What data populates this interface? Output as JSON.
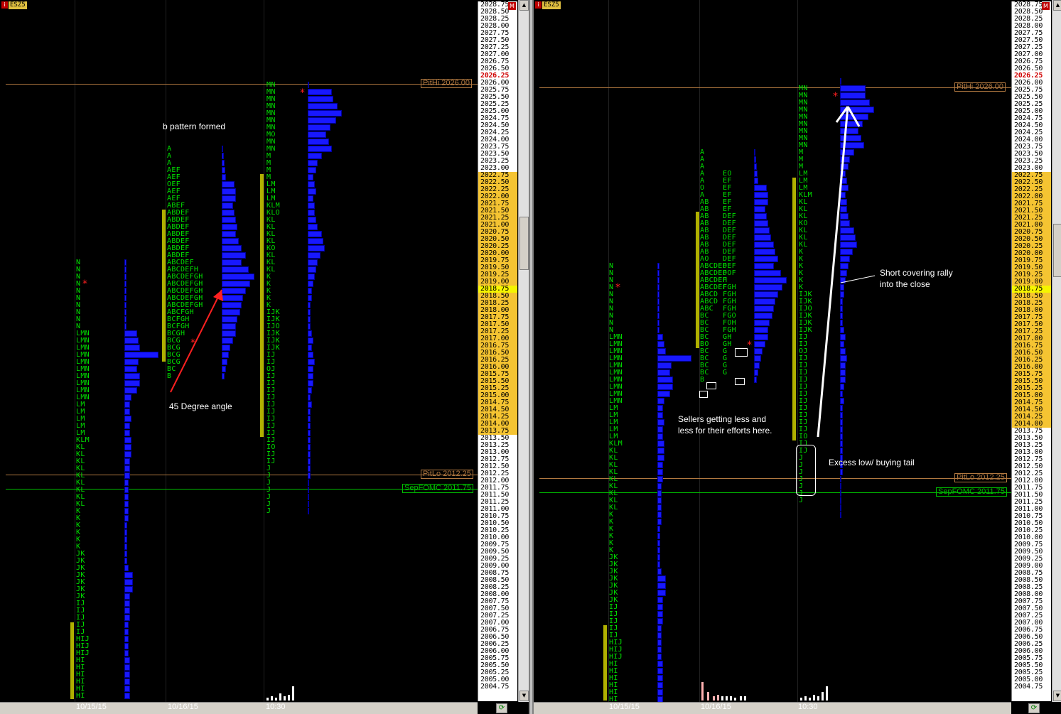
{
  "symbol": "ESZ5",
  "symbol_icon": "i",
  "axis_m_icon": "M",
  "prices_left": [
    "2028.75",
    "2028.50",
    "2028.25",
    "2028.00",
    "2027.75",
    "2027.50",
    "2027.25",
    "2027.00",
    "2026.75",
    "2026.50",
    "2026.25",
    "2026.00",
    "2025.75",
    "2025.50",
    "2025.25",
    "2025.00",
    "2024.75",
    "2024.50",
    "2024.25",
    "2024.00",
    "2023.75",
    "2023.50",
    "2023.25",
    "2023.00",
    "2022.75",
    "2022.50",
    "2022.25",
    "2022.00",
    "2021.75",
    "2021.50",
    "2021.25",
    "2021.00",
    "2020.75",
    "2020.50",
    "2020.25",
    "2020.00",
    "2019.75",
    "2019.50",
    "2019.25",
    "2019.00",
    "2018.75",
    "2018.50",
    "2018.25",
    "2018.00",
    "2017.75",
    "2017.50",
    "2017.25",
    "2017.00",
    "2016.75",
    "2016.50",
    "2016.25",
    "2016.00",
    "2015.75",
    "2015.50",
    "2015.25",
    "2015.00",
    "2014.75",
    "2014.50",
    "2014.25",
    "2014.00",
    "2013.75",
    "2013.50",
    "2013.25",
    "2013.00",
    "2012.75",
    "2012.50",
    "2012.25",
    "2012.00",
    "2011.75",
    "2011.50",
    "2011.25",
    "2011.00",
    "2010.75",
    "2010.50",
    "2010.25",
    "2010.00",
    "2009.75",
    "2009.50",
    "2009.25",
    "2009.00",
    "2008.75",
    "2008.50",
    "2008.25",
    "2008.00",
    "2007.75",
    "2007.50",
    "2007.25",
    "2007.00",
    "2006.75",
    "2006.50",
    "2006.25",
    "2006.00",
    "2005.75",
    "2005.50",
    "2005.25",
    "2005.00",
    "2004.75"
  ],
  "prices_right": [
    "2028.75",
    "2028.50",
    "2028.25",
    "2028.00",
    "2027.75",
    "2027.50",
    "2027.25",
    "2027.00",
    "2026.75",
    "2026.50",
    "2026.25",
    "2026.00",
    "2025.75",
    "2025.50",
    "2025.25",
    "2025.00",
    "2024.75",
    "2024.50",
    "2024.25",
    "2024.00",
    "2023.75",
    "2023.50",
    "2023.25",
    "2023.00",
    "2022.75",
    "2022.50",
    "2022.25",
    "2022.00",
    "2021.75",
    "2021.50",
    "2021.25",
    "2021.00",
    "2020.75",
    "2020.50",
    "2020.25",
    "2020.00",
    "2019.75",
    "2019.50",
    "2019.25",
    "2019.00",
    "2018.75",
    "2018.50",
    "2018.25",
    "2018.00",
    "2017.75",
    "2017.50",
    "2017.25",
    "2017.00",
    "2016.75",
    "2016.50",
    "2016.25",
    "2016.00",
    "2015.75",
    "2015.50",
    "2015.25",
    "2015.00",
    "2014.75",
    "2014.50",
    "2014.25",
    "2014.00",
    "2013.75",
    "2013.50",
    "2013.25",
    "2013.00",
    "2012.75",
    "2012.50",
    "2012.25",
    "2012.00",
    "2011.75",
    "2011.50",
    "2011.25",
    "2011.00",
    "2010.75",
    "2010.50",
    "2010.25",
    "2010.00",
    "2009.75",
    "2009.50",
    "2009.25",
    "2009.00",
    "2008.75",
    "2008.50",
    "2008.25",
    "2008.00",
    "2007.75",
    "2007.50",
    "2007.25",
    "2007.00",
    "2006.75",
    "2006.50",
    "2006.25",
    "2006.00",
    "2005.75",
    "2005.50",
    "2005.25",
    "2005.00",
    "2004.75"
  ],
  "ref_lines": {
    "pithi": "PitHi 2026.00",
    "pitlo": "PitLo 2012.25",
    "fomc": "SepFOMC 2011.75"
  },
  "dates": [
    "10/15/15",
    "10/16/15",
    "10:30"
  ],
  "annotations_left": {
    "b_pattern": "b pattern formed",
    "degree": "45 Degree angle"
  },
  "annotations_right": {
    "sellers_line1": "Sellers getting less and",
    "sellers_line2": "less for their efforts here.",
    "short_line1": "Short covering rally",
    "short_line2": "into the close",
    "excess": "Excess low/ buying tail"
  },
  "tpo_left_col1": [
    "N",
    "N",
    "N",
    "N",
    "N",
    "N",
    "N",
    "N",
    "N",
    "N",
    "LMN",
    "LMN",
    "LMN",
    "LMN",
    "LMN",
    "LMN",
    "LMN",
    "LMN",
    "LMN",
    "LMN",
    "LM",
    "LM",
    "LM",
    "LM",
    "LM",
    "KLM",
    "KL",
    "KL",
    "KL",
    "KL",
    "KL",
    "KL",
    "KL",
    "KL",
    "KL",
    "K",
    "K",
    "K",
    "K",
    "K",
    "K",
    "JK",
    "JK",
    "JK",
    "JK",
    "JK",
    "JK",
    "JK",
    "IJ",
    "IJ",
    "IJ",
    "IJ",
    "IJ",
    "HIJ",
    "HIJ",
    "HIJ",
    "HI",
    "HI",
    "HI",
    "HI",
    "HI",
    "HI"
  ],
  "tpo_left_col2": [
    "A",
    "A",
    "A",
    "AEF",
    "AEF",
    "OEF",
    "AEF",
    "AEF",
    "ABEF",
    "ABDEF",
    "ABDEF",
    "ABDEF",
    "ABDEF",
    "ABDEF",
    "ABDEF",
    "ABDEF",
    "ABCDEF",
    "ABCDEFH",
    "ABCDEFGH",
    "ABCDEFGH",
    "ABCDEFGH",
    "ABCDEFGH",
    "ABCDEFGH",
    "ABCFGH",
    "BCFGH",
    "BCFGH",
    "BCGH",
    "BCG",
    "BCG",
    "BCG",
    "BCG",
    "BC",
    "B"
  ],
  "tpo_left_col3": [
    "MN",
    "MN",
    "MN",
    "MN",
    "MN",
    "MN",
    "MN",
    "MO",
    "MN",
    "MN",
    "M",
    "M",
    "M",
    "M",
    "LM",
    "LM",
    "LM",
    "KLM",
    "KLO",
    "KL",
    "KL",
    "KL",
    "KL",
    "KO",
    "KL",
    "KL",
    "KL",
    "K",
    "K",
    "K",
    "K",
    "K",
    "IJK",
    "IJK",
    "IJO",
    "IJK",
    "IJK",
    "IJK",
    "IJ",
    "IJ",
    "OJ",
    "IJ",
    "IJ",
    "IJ",
    "IJ",
    "IJ",
    "IJ",
    "IJ",
    "IJ",
    "IJ",
    "IJ",
    "IO",
    "IJ",
    "IJ",
    "J",
    "J",
    "J",
    "J",
    "J",
    "J",
    "J"
  ],
  "tpo_right_col1": [
    "N",
    "N",
    "N",
    "N",
    "N",
    "N",
    "N",
    "N",
    "N",
    "N",
    "LMN",
    "LMN",
    "LMN",
    "LMN",
    "LMN",
    "LMN",
    "LMN",
    "LMN",
    "LMN",
    "LMN",
    "LM",
    "LM",
    "LM",
    "LM",
    "LM",
    "KLM",
    "KL",
    "KL",
    "KL",
    "KL",
    "KL",
    "KL",
    "KL",
    "KL",
    "KL",
    "K",
    "K",
    "K",
    "K",
    "K",
    "K",
    "JK",
    "JK",
    "JK",
    "JK",
    "JK",
    "JK",
    "JK",
    "IJ",
    "IJ",
    "IJ",
    "IJ",
    "IJ",
    "HIJ",
    "HIJ",
    "HIJ",
    "HI",
    "HI",
    "HI",
    "HI",
    "HI",
    "HI"
  ],
  "tpo_right_col2a": [
    "A",
    "A",
    "A",
    "A",
    "A",
    "O",
    "A",
    "AB",
    "AB",
    "AB",
    "AB",
    "AB",
    "AB",
    "AB",
    "AB",
    "AO",
    "ABCDEF",
    "ABCDEF",
    "ABCDEF",
    "ABCDEF",
    "ABCD",
    "ABCD",
    "ABC",
    "BC",
    "BC",
    "BC",
    "BC",
    "BO",
    "BC",
    "BC",
    "BC",
    "BC",
    "B"
  ],
  "tpo_right_col2b": [
    "EO",
    "EF",
    "EF",
    "EF",
    "EF",
    "EF",
    "DEF",
    "DEF",
    "DEF",
    "DEF",
    "DEF",
    "DEF",
    "DEF",
    "DEF",
    "DOF",
    "H",
    "FGH",
    "FGH",
    "FGH",
    "FGH",
    "FGO",
    "FOH",
    "FGH",
    "GH",
    "GH",
    "G",
    "G",
    "G",
    "G"
  ],
  "tpo_right_col3": [
    "MN",
    "MN",
    "MN",
    "MN",
    "MN",
    "MN",
    "MN",
    "MN",
    "MN",
    "M",
    "M",
    "M",
    "LM",
    "LM",
    "LM",
    "KLM",
    "KL",
    "KL",
    "KL",
    "KO",
    "KL",
    "KL",
    "KL",
    "K",
    "K",
    "K",
    "K",
    "K",
    "K",
    "IJK",
    "IJK",
    "IJO",
    "IJK",
    "IJK",
    "IJK",
    "IJ",
    "IJ",
    "OJ",
    "IJ",
    "IJ",
    "IJ",
    "IJ",
    "IJ",
    "IJ",
    "IJ",
    "IJ",
    "IJ",
    "IJ",
    "IJ",
    "IO",
    "IJ",
    "IJ",
    "J",
    "J",
    "J",
    "J",
    "J",
    "J",
    "J"
  ],
  "colors": {
    "tpo": "#00e000",
    "hist": "#1818ff",
    "value_area": "#f5c432",
    "pithi": "#b07840",
    "fomc": "#00c000"
  }
}
